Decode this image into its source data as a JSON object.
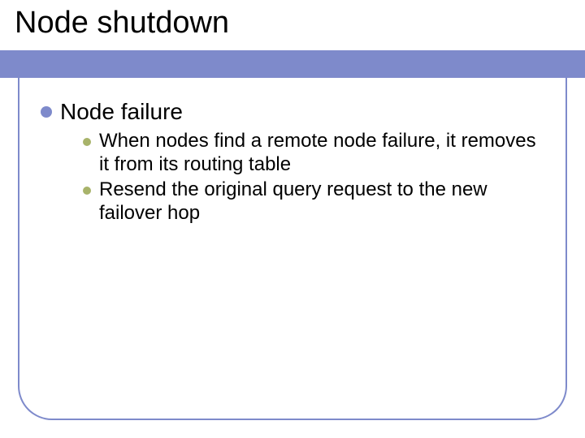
{
  "slide": {
    "title": "Node shutdown",
    "level1": {
      "text": "Node failure"
    },
    "level2": [
      {
        "text": "When nodes find a remote node failure, it removes it from its routing table"
      },
      {
        "text": "Resend the original query request to the new failover hop"
      }
    ]
  },
  "colors": {
    "accent": "#7e8acb",
    "sub_bullet": "#a8b36a"
  }
}
